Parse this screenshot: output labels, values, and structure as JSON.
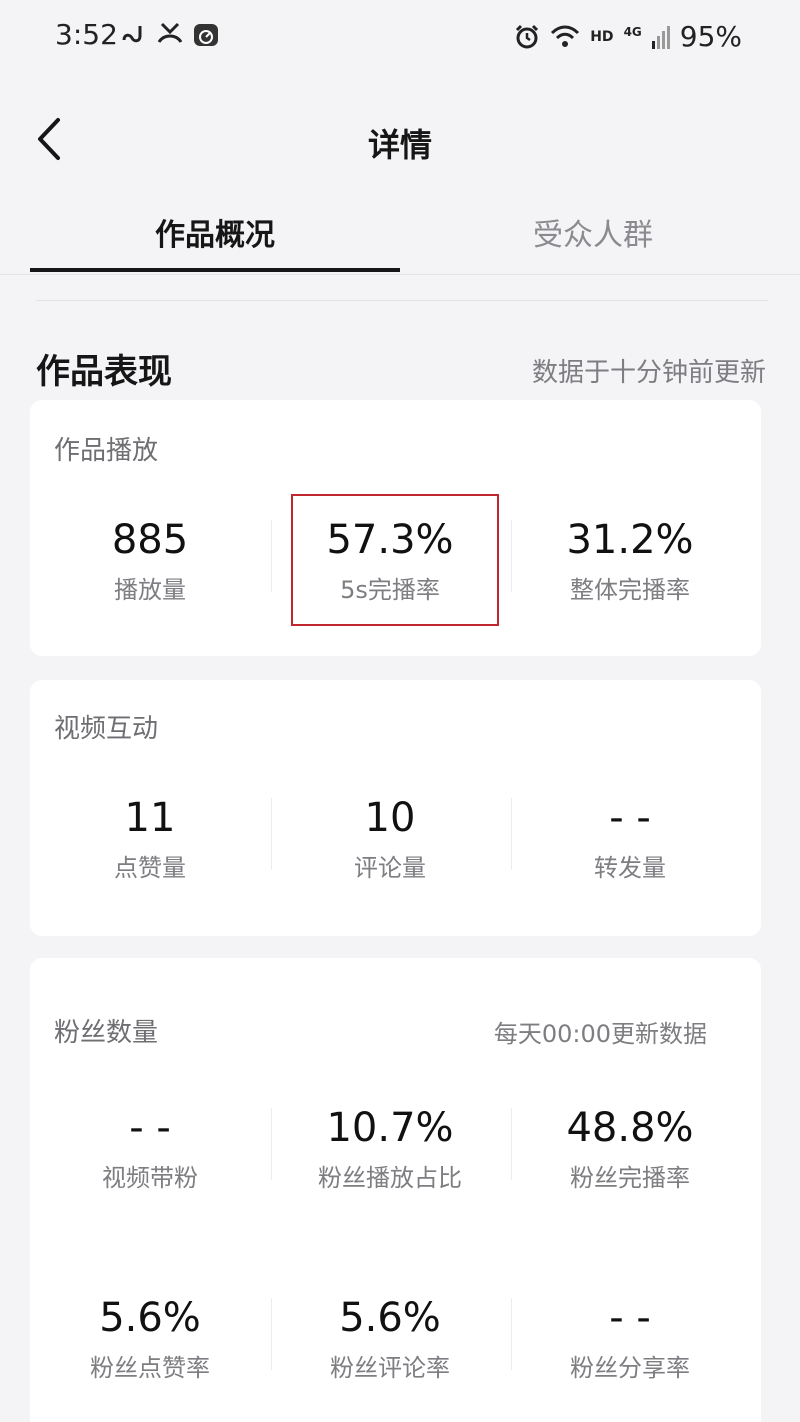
{
  "status_bar": {
    "time": "3:52",
    "hd": "HD",
    "network": "4G",
    "battery": "95%",
    "icons": [
      "link-icon",
      "missed-call-icon",
      "speedometer-icon",
      "alarm-icon",
      "wifi-icon",
      "signal-icon"
    ]
  },
  "header": {
    "title": "详情",
    "back_icon": "chevron-left-icon"
  },
  "tabs": [
    {
      "label": "作品概况",
      "active": true
    },
    {
      "label": "受众人群",
      "active": false
    }
  ],
  "section": {
    "title": "作品表现",
    "note": "数据于十分钟前更新"
  },
  "cards": {
    "playback": {
      "title": "作品播放",
      "metrics": [
        {
          "value": "885",
          "label": "播放量"
        },
        {
          "value": "57.3%",
          "label": "5s完播率"
        },
        {
          "value": "31.2%",
          "label": "整体完播率"
        }
      ]
    },
    "interaction": {
      "title": "视频互动",
      "metrics": [
        {
          "value": "11",
          "label": "点赞量"
        },
        {
          "value": "10",
          "label": "评论量"
        },
        {
          "value": "- -",
          "label": "转发量"
        }
      ]
    },
    "fans": {
      "title": "粉丝数量",
      "note": "每天00:00更新数据",
      "metrics": [
        {
          "value": "- -",
          "label": "视频带粉"
        },
        {
          "value": "10.7%",
          "label": "粉丝播放占比"
        },
        {
          "value": "48.8%",
          "label": "粉丝完播率"
        },
        {
          "value": "5.6%",
          "label": "粉丝点赞率"
        },
        {
          "value": "5.6%",
          "label": "粉丝评论率"
        },
        {
          "value": "- -",
          "label": "粉丝分享率"
        }
      ]
    }
  },
  "colors": {
    "highlight_border": "#c0262b",
    "background": "#f4f4f6",
    "card": "#ffffff"
  }
}
